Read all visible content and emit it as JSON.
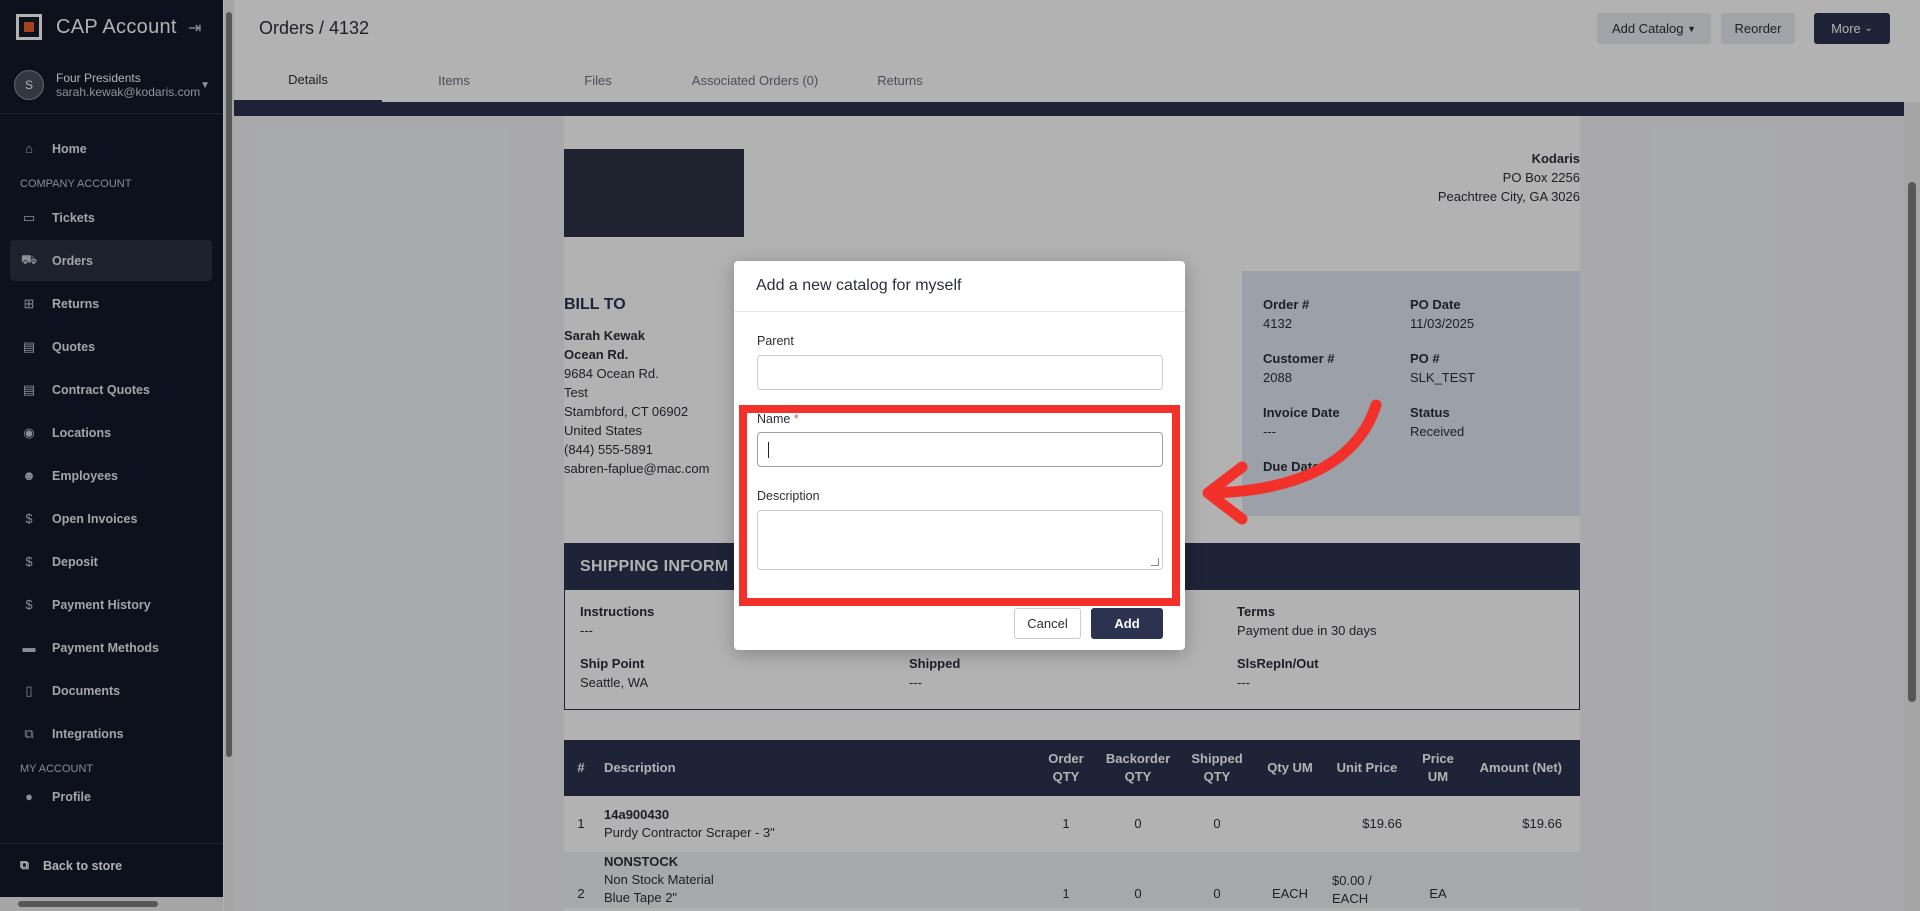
{
  "app": {
    "title": "CAP Account"
  },
  "user": {
    "initial": "S",
    "company": "Four Presidents",
    "email": "sarah.kewak@kodaris.com"
  },
  "sidebar": {
    "home": "Home",
    "company_section": "COMPANY ACCOUNT",
    "items": [
      {
        "label": "Tickets",
        "icon": "ticket-icon"
      },
      {
        "label": "Orders",
        "icon": "truck-icon",
        "active": true
      },
      {
        "label": "Returns",
        "icon": "return-box-icon"
      },
      {
        "label": "Quotes",
        "icon": "clipboard-icon"
      },
      {
        "label": "Contract Quotes",
        "icon": "clipboard-icon"
      },
      {
        "label": "Locations",
        "icon": "map-pin-icon"
      },
      {
        "label": "Employees",
        "icon": "people-icon"
      },
      {
        "label": "Open Invoices",
        "icon": "dollar-icon"
      },
      {
        "label": "Deposit",
        "icon": "dollar-icon"
      },
      {
        "label": "Payment History",
        "icon": "dollar-icon"
      },
      {
        "label": "Payment Methods",
        "icon": "card-icon"
      },
      {
        "label": "Documents",
        "icon": "document-icon"
      },
      {
        "label": "Integrations",
        "icon": "integration-icon"
      }
    ],
    "my_account_section": "MY ACCOUNT",
    "profile": "Profile",
    "back_to_store": "Back to store"
  },
  "header": {
    "breadcrumb": "Orders / 4132",
    "add_catalog": "Add Catalog",
    "reorder": "Reorder",
    "more": "More"
  },
  "tabs": [
    "Details",
    "Items",
    "Files",
    "Associated Orders (0)",
    "Returns"
  ],
  "company_address": {
    "name": "Kodaris",
    "line1": "PO Box 2256",
    "line2": "Peachtree City, GA 3026"
  },
  "bill_to": {
    "heading": "BILL TO",
    "name": "Sarah Kewak",
    "street_name": "Ocean Rd.",
    "address": "9684 Ocean Rd.",
    "line2": "Test",
    "city": "Stambford, CT 06902",
    "country": "United States",
    "phone": "(844) 555-5891",
    "email": "sabren-faplue@mac.com"
  },
  "order_info": {
    "order_no_label": "Order #",
    "order_no": "4132",
    "po_date_label": "PO Date",
    "po_date": "11/03/2025",
    "customer_label": "Customer #",
    "customer": "2088",
    "po_label": "PO #",
    "po": "SLK_TEST",
    "invoice_date_label": "Invoice Date",
    "invoice_date": "---",
    "status_label": "Status",
    "status": "Received",
    "due_date_label": "Due Date"
  },
  "shipping": {
    "heading": "SHIPPING INFORM",
    "instructions_label": "Instructions",
    "instructions": "---",
    "terms_label": "Terms",
    "terms": "Payment due in 30 days",
    "ship_point_label": "Ship Point",
    "ship_point": "Seattle, WA",
    "shipped_label": "Shipped",
    "shipped": "---",
    "slsrep_label": "SlsRepIn/Out",
    "slsrep": "---"
  },
  "items_table": {
    "headers": [
      "#",
      "Description",
      "Order QTY",
      "Backorder QTY",
      "Shipped QTY",
      "Qty UM",
      "Unit Price",
      "Price UM",
      "Amount (Net)"
    ],
    "rows": [
      {
        "num": "1",
        "sku": "14a900430",
        "desc": "Purdy Contractor Scraper - 3\"",
        "order": "1",
        "back": "0",
        "shipped": "0",
        "qtyum": "",
        "price": "$19.66",
        "priceum": "",
        "amount": "$19.66"
      },
      {
        "num": "2",
        "sku": "NONSTOCK",
        "desc": "Non Stock Material",
        "desc2": "Blue Tape 2\"",
        "order": "1",
        "back": "0",
        "shipped": "0",
        "qtyum": "EACH",
        "price": "$0.00 /",
        "price2": "EACH",
        "priceum": "EA",
        "amount": ""
      }
    ]
  },
  "modal": {
    "title": "Add a new catalog for myself",
    "parent_label": "Parent",
    "name_label": "Name",
    "required_mark": "*",
    "description_label": "Description",
    "cancel": "Cancel",
    "add": "Add"
  },
  "annotation_colors": {
    "highlight": "#f2312b"
  }
}
